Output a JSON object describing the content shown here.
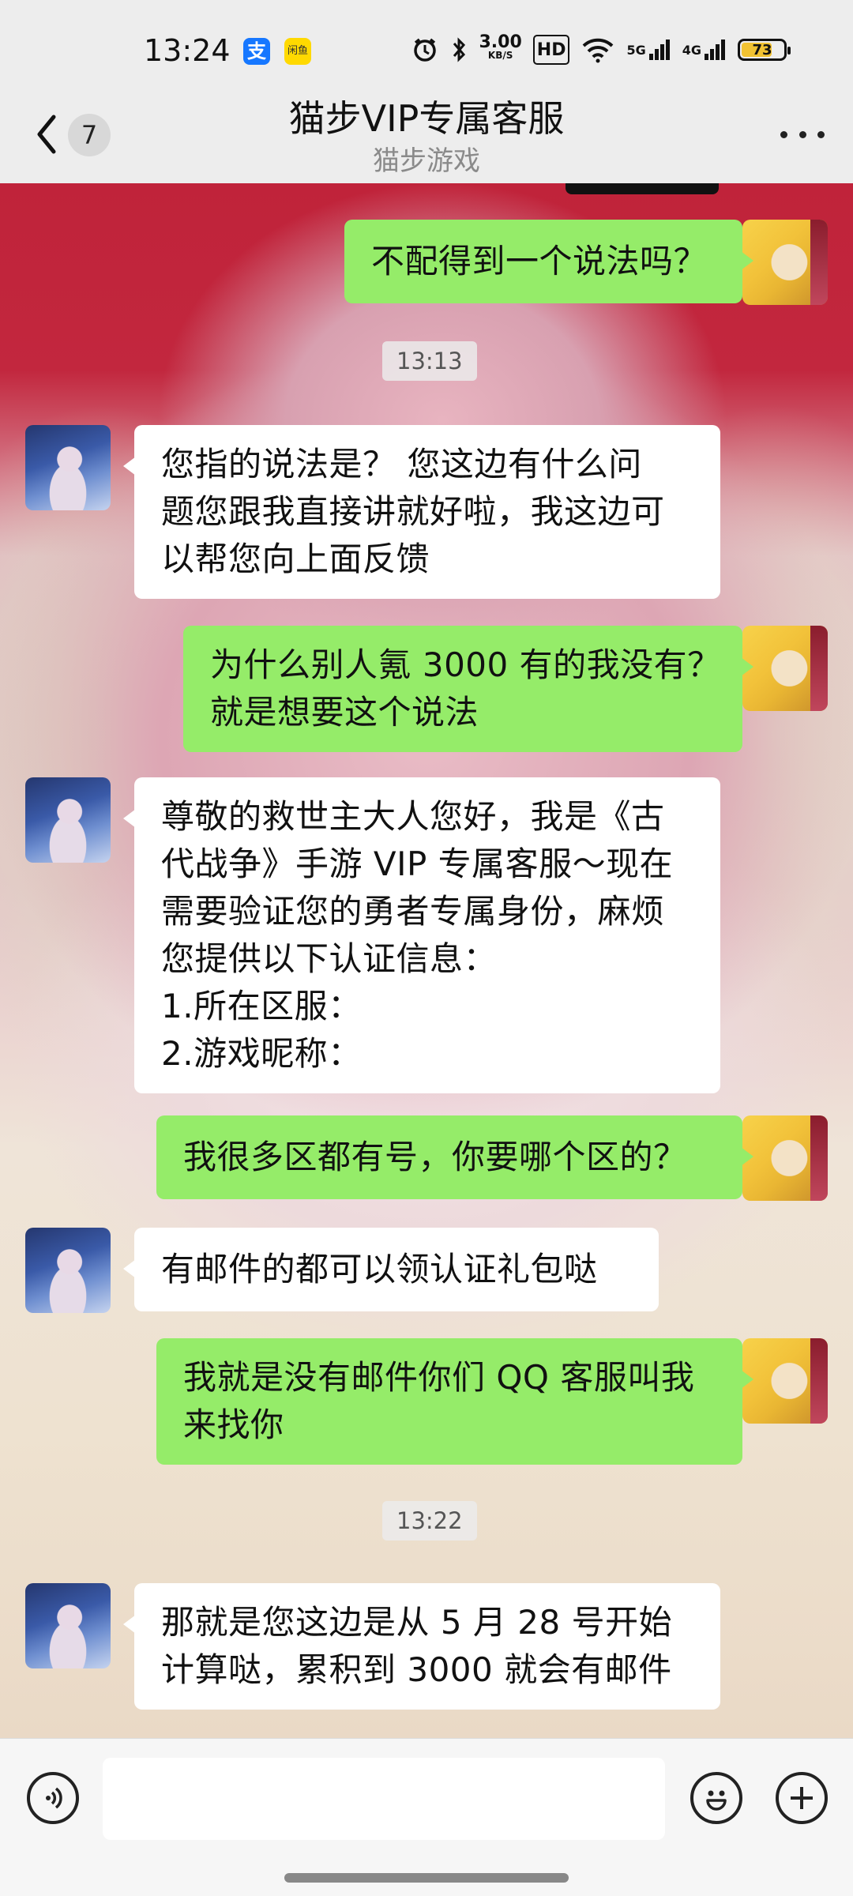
{
  "status_bar": {
    "time": "13:24",
    "speed_value": "3.00",
    "speed_unit": "KB/S",
    "hd_label": "HD",
    "net_5g": "5G",
    "net_4g": "4G",
    "battery": "73",
    "battery_level": 0.73,
    "alipay_glyph": "支",
    "xianyu_glyph": "闲鱼"
  },
  "header": {
    "back_badge": "7",
    "title": "猫步VIP专属客服",
    "subtitle": "猫步游戏"
  },
  "messages": [
    {
      "type": "self",
      "lines": [
        "不配得到一个说法吗？"
      ]
    },
    {
      "type": "time",
      "text": "13:13"
    },
    {
      "type": "agent",
      "lines": [
        "您指的说法是？ 您这边有什么问",
        "题您跟我直接讲就好啦，我这边可",
        "以帮您向上面反馈"
      ]
    },
    {
      "type": "self",
      "lines": [
        "为什么别人氪 3000 有的我没有？",
        "就是想要这个说法"
      ]
    },
    {
      "type": "agent",
      "lines": [
        "尊敬的救世主大人您好，我是《古",
        "代战争》手游 VIP 专属客服～现在",
        "需要验证您的勇者专属身份，麻烦",
        "您提供以下认证信息：",
        "1.所在区服：",
        "2.游戏昵称："
      ]
    },
    {
      "type": "self",
      "lines": [
        "我很多区都有号，你要哪个区的？"
      ]
    },
    {
      "type": "agent",
      "lines": [
        "有邮件的都可以领认证礼包哒"
      ]
    },
    {
      "type": "self",
      "lines": [
        "我就是没有邮件你们 QQ 客服叫我",
        "来找你"
      ]
    },
    {
      "type": "time",
      "text": "13:22"
    },
    {
      "type": "agent",
      "lines": [
        "那就是您这边是从 5 月 28 号开始",
        "计算哒，累积到 3000 就会有邮件"
      ]
    }
  ],
  "input": {
    "placeholder": ""
  },
  "colors": {
    "self_bubble": "#95ec69",
    "agent_bubble": "#ffffff",
    "header_bg": "#ededed"
  }
}
